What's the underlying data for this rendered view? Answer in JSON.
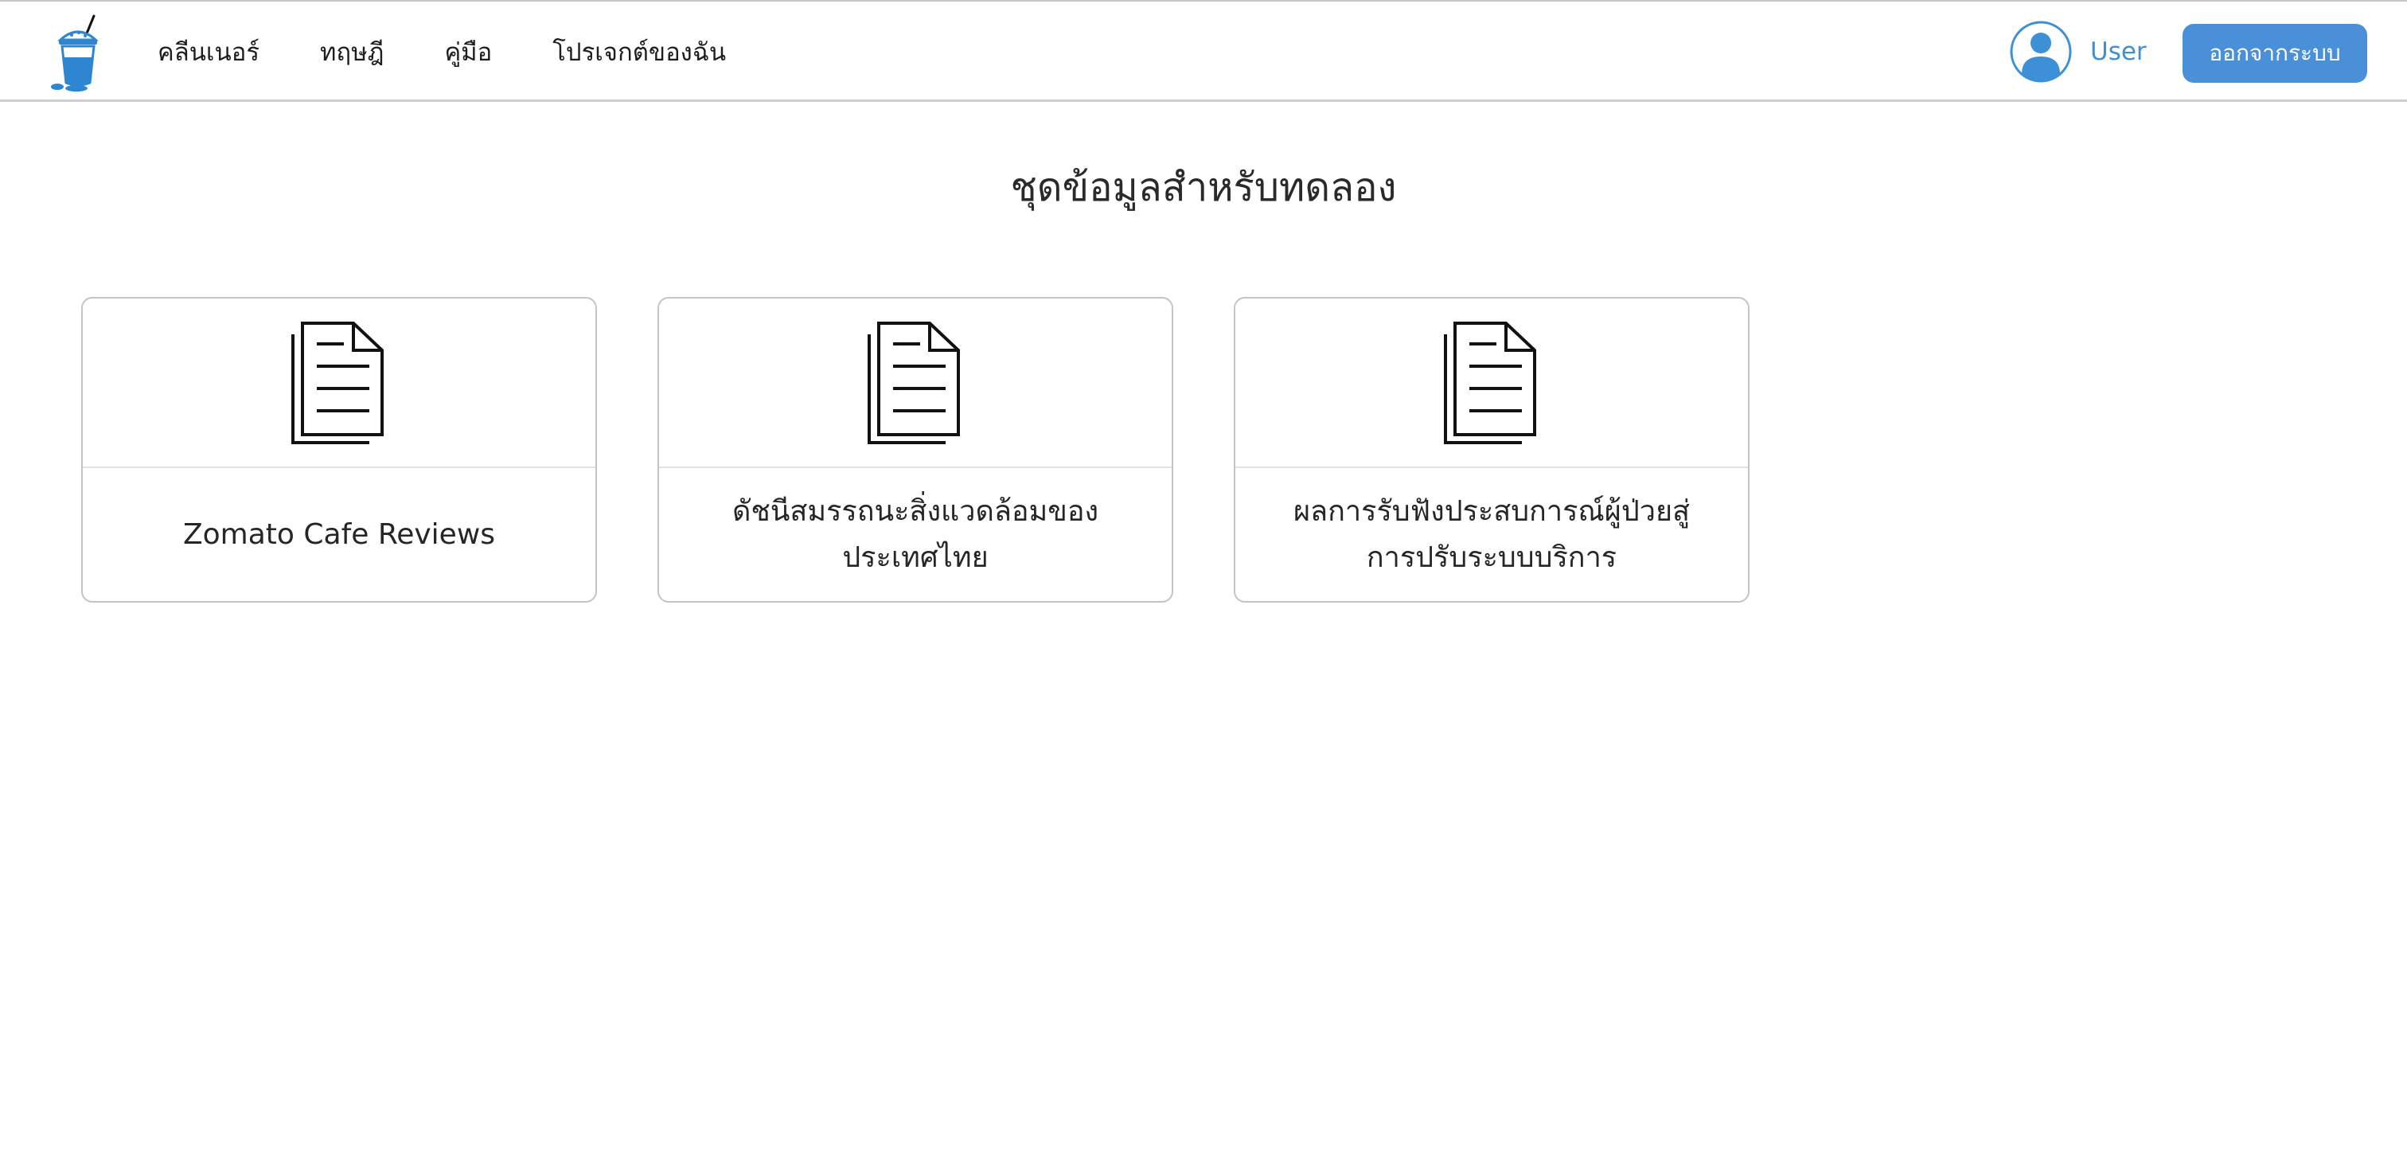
{
  "nav": {
    "links": [
      "คลีนเนอร์",
      "ทฤษฎี",
      "คู่มือ",
      "โปรเจกต์ของฉัน"
    ],
    "user_name": "User",
    "logout_label": "ออกจากระบบ"
  },
  "page": {
    "title": "ชุดข้อมูลสำหรับทดลอง"
  },
  "datasets": [
    {
      "title": "Zomato Cafe Reviews",
      "icon": "document-icon"
    },
    {
      "title": "ดัชนีสมรรถนะสิ่งแวดล้อมของประเทศไทย",
      "icon": "document-icon"
    },
    {
      "title": "ผลการรับฟังประสบการณ์ผู้ป่วยสู่การปรับระบบบริการ",
      "icon": "document-icon"
    }
  ],
  "colors": {
    "accent": "#4a90d9",
    "user_text": "#3d8fd6",
    "logo_blue": "#2f86d0"
  }
}
